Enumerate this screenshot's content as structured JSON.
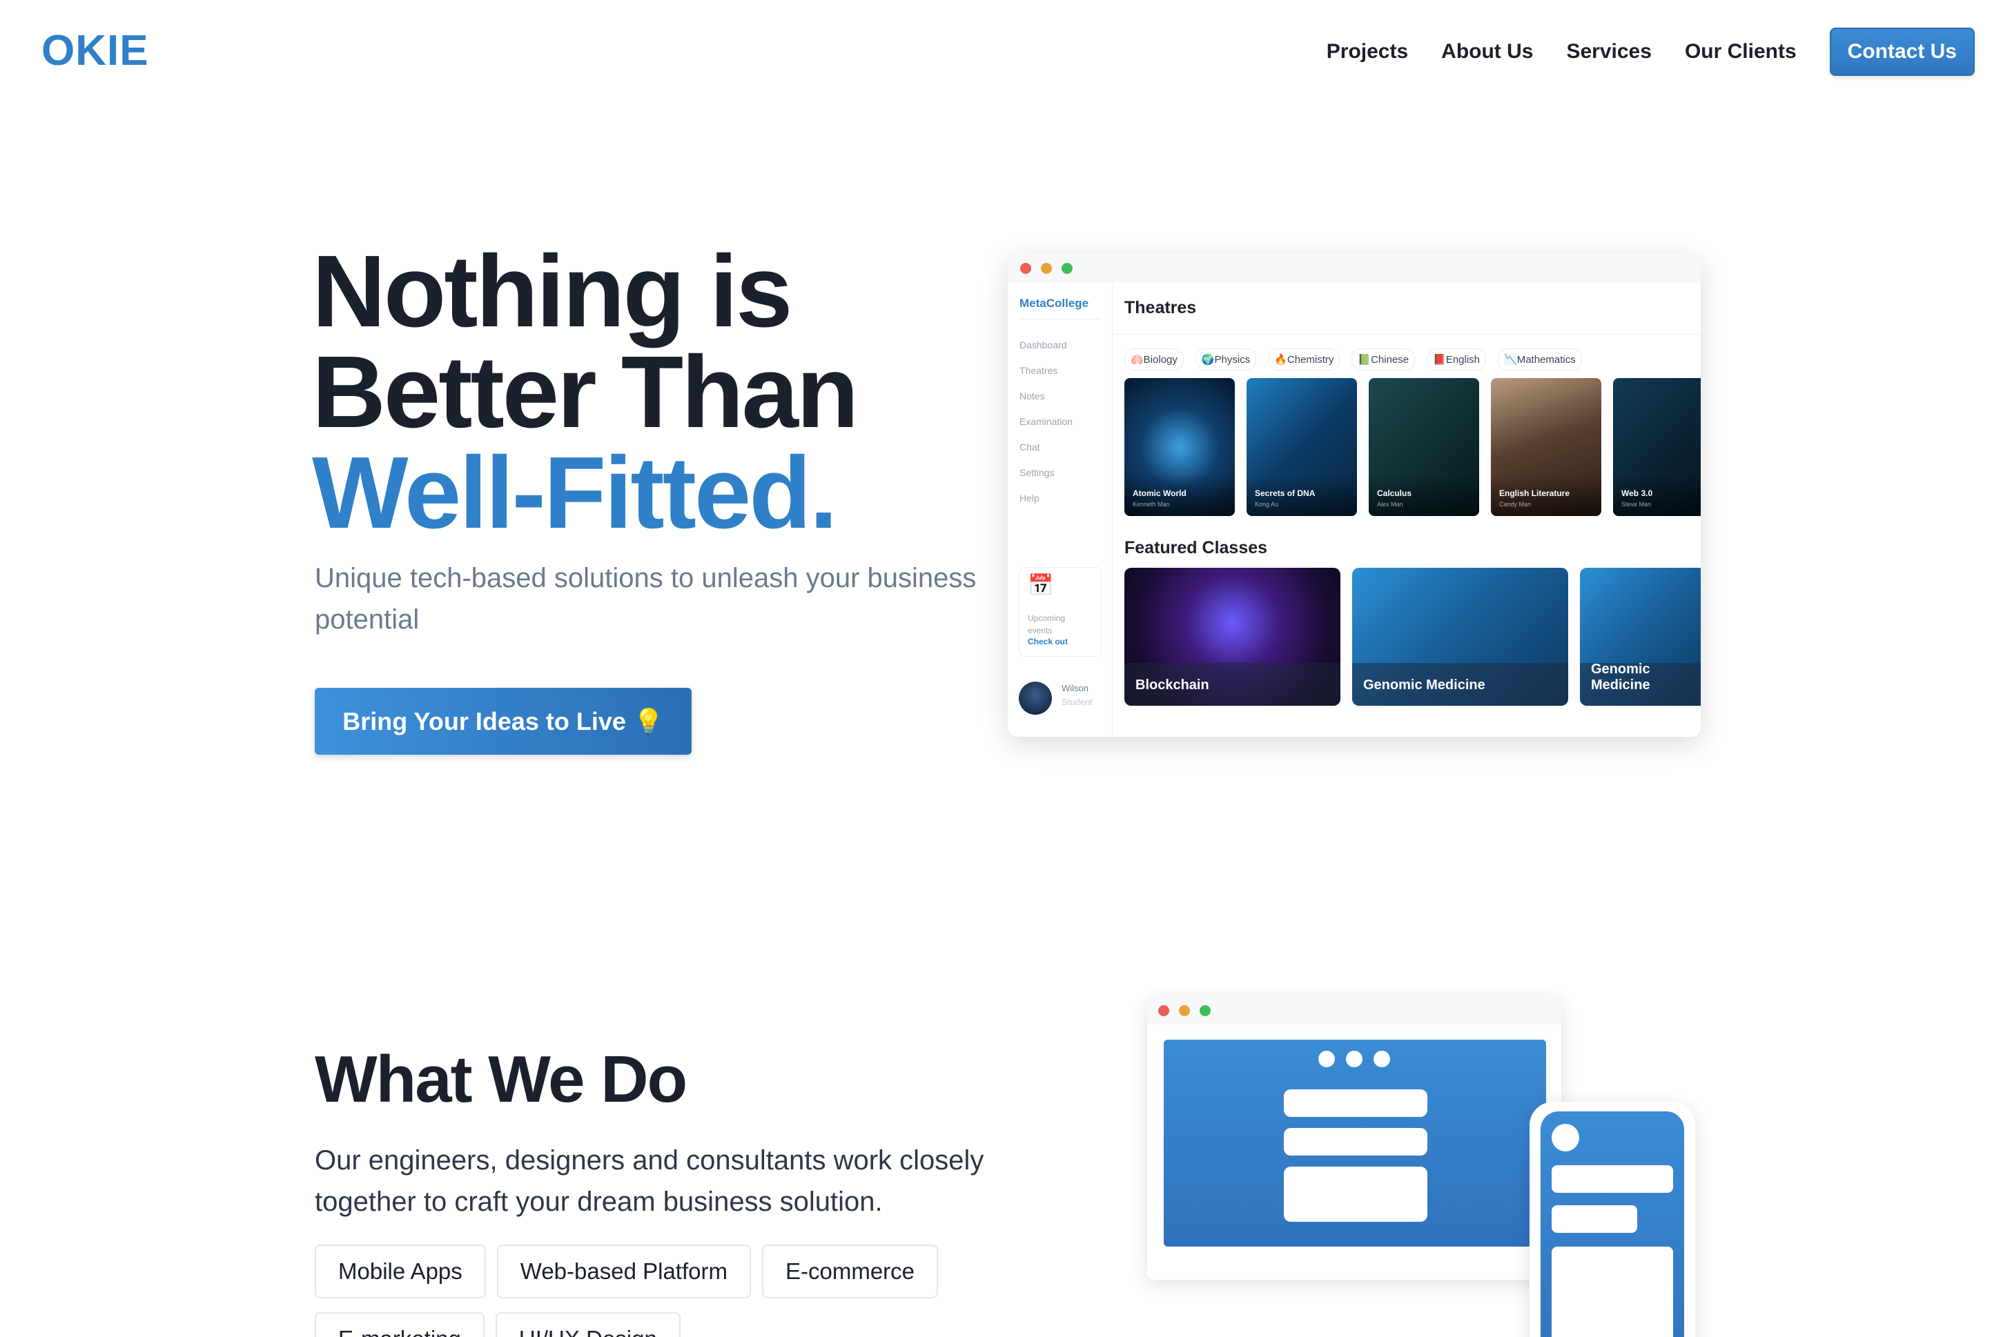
{
  "header": {
    "logo": "OKIE",
    "nav": [
      "Projects",
      "About Us",
      "Services",
      "Our Clients"
    ],
    "contact": "Contact Us"
  },
  "hero": {
    "line1": "Nothing is",
    "line2": "Better Than",
    "line3": "Well-Fitted.",
    "subtitle": "Unique tech-based solutions to unleash your business potential",
    "cta": "Bring Your Ideas to Live 💡"
  },
  "app": {
    "brand": "MetaCollege",
    "menu": [
      "Dashboard",
      "Theatres",
      "Notes",
      "Examination",
      "Chat",
      "Settings",
      "Help"
    ],
    "events_text": "Upcoming events",
    "events_link": "Check out",
    "user_name": "Wilson",
    "user_role": "Student",
    "theatres_title": "Theatres",
    "chips": [
      "🫁Biology",
      "🌍Physics",
      "🔥Chemistry",
      "📗Chinese",
      "📕English",
      "📉Mathematics"
    ],
    "tiles": [
      {
        "name": "Atomic World",
        "author": "Kenneth Man"
      },
      {
        "name": "Secrets of DNA",
        "author": "Kong Au"
      },
      {
        "name": "Calculus",
        "author": "Alex Man"
      },
      {
        "name": "English Literature",
        "author": "Candy Man"
      },
      {
        "name": "Web 3.0",
        "author": "Steve Man"
      }
    ],
    "featured_title": "Featured Classes",
    "classes": [
      "Blockchain",
      "Genomic Medicine",
      "Genomic Medicine"
    ]
  },
  "wwd": {
    "title": "What We Do",
    "subtitle": "Our engineers, designers and consultants work closely together to craft your dream business solution.",
    "tags": [
      "Mobile Apps",
      "Web-based Platform",
      "E-commerce",
      "E-marketing",
      "UI/UX Design"
    ]
  },
  "colors": {
    "brand": "#2f80c8",
    "text": "#1a202c",
    "muted": "#6b7a90"
  }
}
